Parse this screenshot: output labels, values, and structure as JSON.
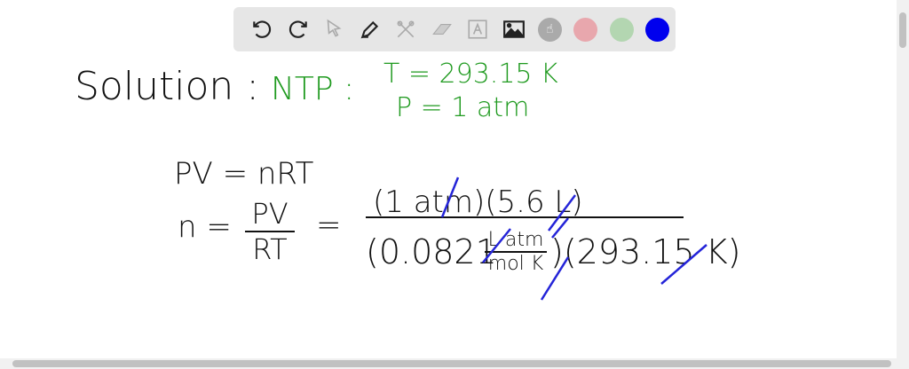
{
  "toolbar": {
    "tools": [
      "undo-icon",
      "redo-icon",
      "select-icon",
      "pen-icon",
      "tools-icon",
      "eraser-icon",
      "text-icon",
      "image-icon",
      "hand-icon"
    ],
    "colors": [
      "#e8a7ad",
      "#b3d6b1",
      "#0000ee"
    ]
  },
  "board": {
    "solution_label": "Solution :",
    "ntp_label": "NTP :",
    "temperature": "T = 293.15 K",
    "pressure": "P = 1 atm",
    "ideal_gas": "PV = nRT",
    "n_eq": "n =",
    "pv": "PV",
    "rt": "RT",
    "equals": "=",
    "numerator": "(1 atm)(5.6 L)",
    "denom_const": "(0.0821",
    "unit_top": "L·atm",
    "unit_bottom": "mol K",
    "denom_temp": ")(293.15 K)"
  }
}
